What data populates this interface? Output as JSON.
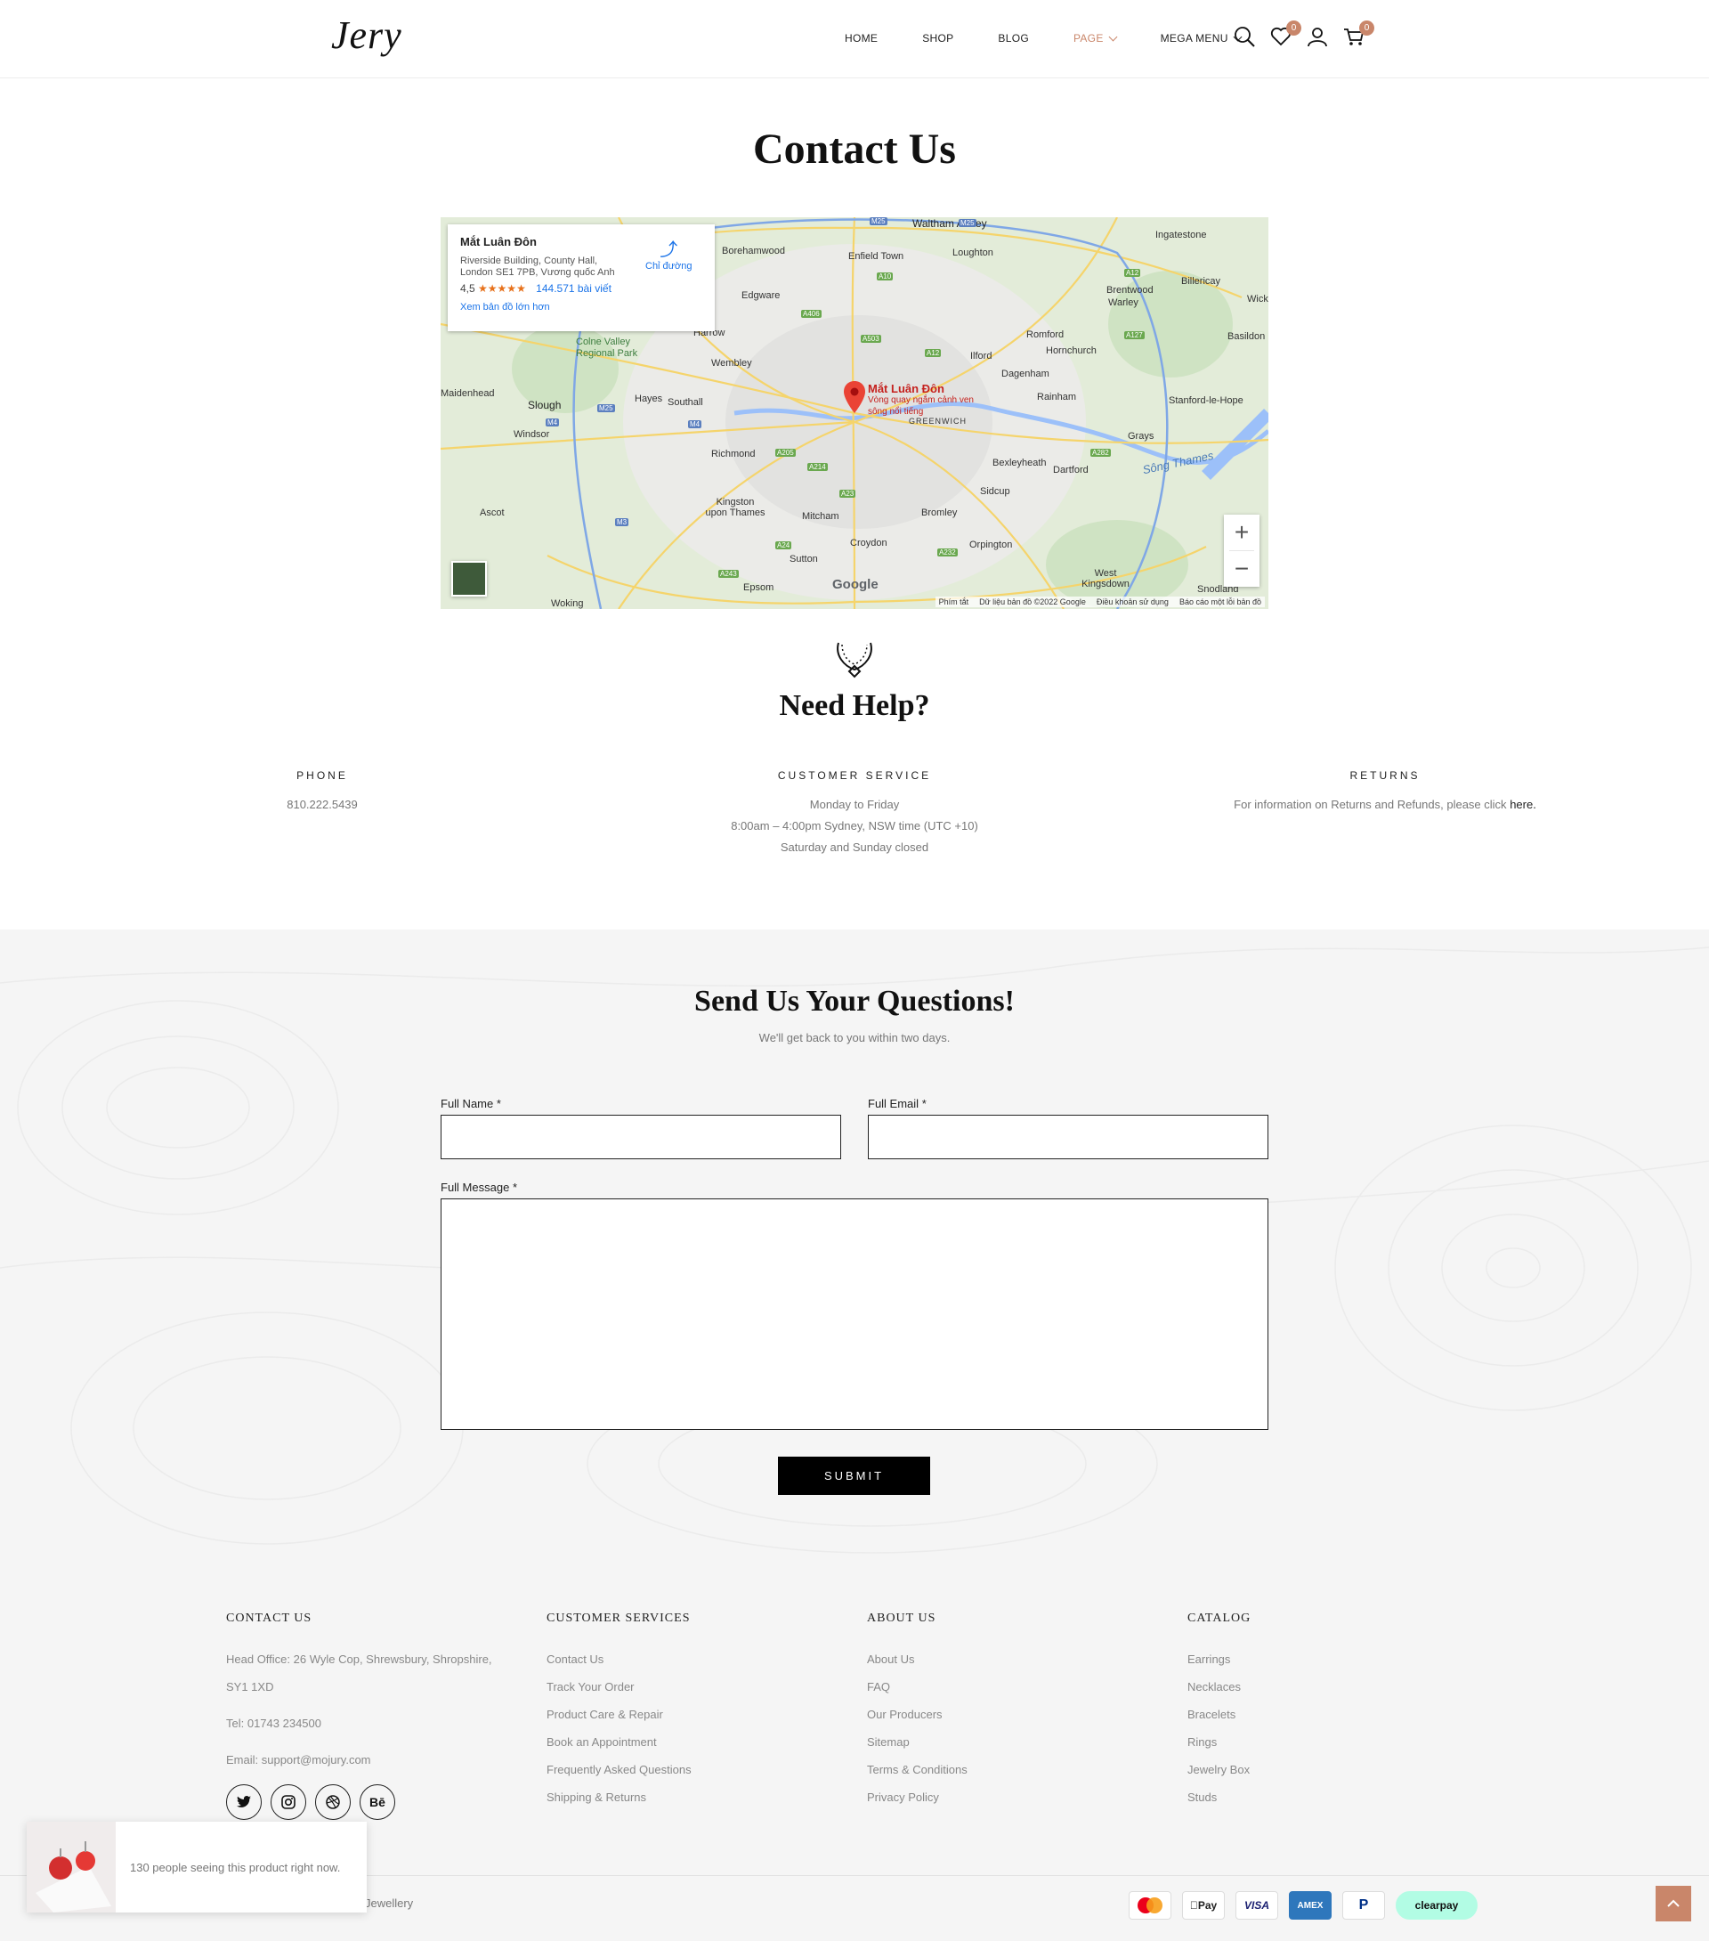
{
  "header": {
    "logo": "Jery",
    "nav": [
      {
        "label": "HOME"
      },
      {
        "label": "SHOP"
      },
      {
        "label": "BLOG"
      },
      {
        "label": "PAGE"
      },
      {
        "label": "MEGA MENU"
      }
    ],
    "wishlist_count": "0",
    "cart_count": "0",
    "accent_color": "#c9866a"
  },
  "page_title": "Contact Us",
  "map": {
    "place_name": "Mắt Luân Đôn",
    "address": "Riverside Building, County Hall, London SE1 7PB, Vương quốc Anh",
    "rating": "4,5",
    "stars": "★★★★★",
    "reviews": "144.571 bài viết",
    "view_larger": "Xem bản đồ lớn hơn",
    "directions": "Chỉ đường",
    "pin_label": "Mắt Luân Đôn",
    "pin_sub": "Vòng quay ngắm cảnh ven sông nổi tiếng",
    "google": "Google",
    "attribution": [
      "Phím tắt",
      "Dữ liệu bản đồ ©2022 Google",
      "Điều khoản sử dụng",
      "Báo cáo một lỗi bản đồ"
    ],
    "places": [
      "Waltham Abbey",
      "Borehamwood",
      "Enfield Town",
      "Loughton",
      "Ingatestone",
      "Billericay",
      "Brentwood",
      "Warley",
      "Edgware",
      "Harrow",
      "Romford",
      "Hornchurch",
      "Basildon",
      "Colne Valley Regional Park",
      "Wembley",
      "Ilford",
      "Dagenham",
      "Maidenhead",
      "Slough",
      "Hayes",
      "Southall",
      "Rainham",
      "Stanford-le-Hope",
      "GREENWICH",
      "Windsor",
      "Richmond",
      "Grays",
      "Bexleyheath",
      "Dartford",
      "Sông Thames",
      "Ascot",
      "Kingston upon Thames",
      "Mitcham",
      "Bromley",
      "Sidcup",
      "Croydon",
      "Orpington",
      "Sutton",
      "West Kingsdown",
      "Epsom",
      "Snodland",
      "Woking",
      "Wick"
    ]
  },
  "help": {
    "title": "Need Help?",
    "phone": {
      "title": "PHONE",
      "value": "810.222.5439"
    },
    "service": {
      "title": "CUSTOMER SERVICE",
      "lines": [
        "Monday to Friday",
        "8:00am – 4:00pm Sydney, NSW time (UTC +10)",
        "Saturday and Sunday closed"
      ]
    },
    "returns": {
      "title": "RETURNS",
      "text": "For information on Returns and Refunds, please click",
      "link": "here."
    }
  },
  "questions": {
    "title": "Send Us Your Questions!",
    "subtitle": "We'll get back to you within two days.",
    "name_label": "Full Name",
    "email_label": "Full Email",
    "message_label": "Full Message",
    "required": "*",
    "submit": "SUBMIT"
  },
  "footer": {
    "contact": {
      "title": "CONTACT US",
      "address_1": "Head Office: 26 Wyle Cop, Shrewsbury, Shropshire,",
      "address_2": "SY1 1XD",
      "tel": "Tel: 01743 234500",
      "email": "Email: support@mojury.com"
    },
    "customer_services": {
      "title": "CUSTOMER SERVICES",
      "items": [
        "Contact Us",
        "Track Your Order",
        "Product Care & Repair",
        "Book an Appointment",
        "Frequently Asked Questions",
        "Shipping & Returns"
      ]
    },
    "about": {
      "title": "ABOUT US",
      "items": [
        "About Us",
        "FAQ",
        "Our Producers",
        "Sitemap",
        "Terms & Conditions",
        "Privacy Policy"
      ]
    },
    "catalog": {
      "title": "CATALOG",
      "items": [
        "Earrings",
        "Necklaces",
        "Bracelets",
        "Rings",
        "Jewelry Box",
        "Studs"
      ]
    },
    "social_icons": [
      "twitter-icon",
      "instagram-icon",
      "dribbble-icon",
      "behance-icon"
    ],
    "behance_text": "Bē",
    "copyright": "Jewellery",
    "payments": {
      "applepay": "Pay",
      "visa": "VISA",
      "amex": "AMEX",
      "clearpay": "clearpay"
    }
  },
  "popup": {
    "text": "130 people seeing this product right now."
  }
}
